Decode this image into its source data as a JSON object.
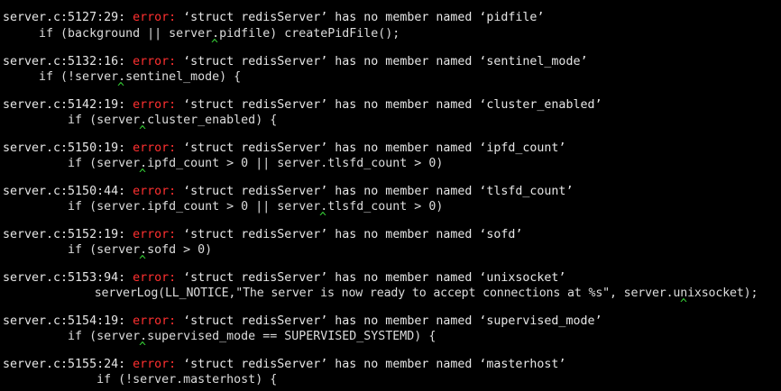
{
  "terminal": {
    "top_caret": "^",
    "errors": [
      {
        "location": "server.c:5127:29: ",
        "level": "error: ",
        "message": "‘struct redisServer’ has no member named ‘pidfile’",
        "source": "     if (background || server.pidfile) createPidFile();",
        "caret": "^"
      },
      {
        "location": "server.c:5132:16: ",
        "level": "error: ",
        "message": "‘struct redisServer’ has no member named ‘sentinel_mode’",
        "source": "     if (!server.sentinel_mode) {",
        "caret": "^"
      },
      {
        "location": "server.c:5142:19: ",
        "level": "error: ",
        "message": "‘struct redisServer’ has no member named ‘cluster_enabled’",
        "source": "         if (server.cluster_enabled) {",
        "caret": "^"
      },
      {
        "location": "server.c:5150:19: ",
        "level": "error: ",
        "message": "‘struct redisServer’ has no member named ‘ipfd_count’",
        "source": "         if (server.ipfd_count > 0 || server.tlsfd_count > 0)",
        "caret": "^"
      },
      {
        "location": "server.c:5150:44: ",
        "level": "error: ",
        "message": "‘struct redisServer’ has no member named ‘tlsfd_count’",
        "source": "         if (server.ipfd_count > 0 || server.tlsfd_count > 0)",
        "caret": "^"
      },
      {
        "location": "server.c:5152:19: ",
        "level": "error: ",
        "message": "‘struct redisServer’ has no member named ‘sofd’",
        "source": "         if (server.sofd > 0)",
        "caret": "^"
      },
      {
        "location": "server.c:5153:94: ",
        "level": "error: ",
        "message": "‘struct redisServer’ has no member named ‘unixsocket’",
        "source": "             serverLog(LL_NOTICE,\"The server is now ready to accept connections at %s\", server.unixsocket);",
        "caret": "^"
      },
      {
        "location": "server.c:5154:19: ",
        "level": "error: ",
        "message": "‘struct redisServer’ has no member named ‘supervised_mode’",
        "source": "         if (server.supervised_mode == SUPERVISED_SYSTEMD) {",
        "caret": "^"
      },
      {
        "location": "server.c:5155:24: ",
        "level": "error: ",
        "message": "‘struct redisServer’ has no member named ‘masterhost’",
        "source": "             if (!server.masterhost) {",
        "caret": ""
      }
    ]
  }
}
